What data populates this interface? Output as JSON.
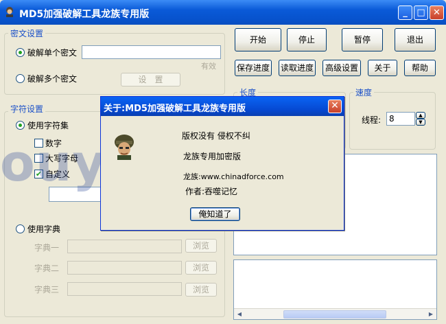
{
  "window": {
    "title": "MD5加强破解工具龙族专用版",
    "minimize": "_",
    "maximize": "□",
    "close": "✕"
  },
  "cipher_group": {
    "title": "密文设置",
    "single_radio": "破解单个密文",
    "single_value": "",
    "valid_label": "有效",
    "multi_radio": "破解多个密文",
    "set_button": "设　置"
  },
  "charset_group": {
    "title": "字符设置",
    "use_charset": "使用字符集",
    "digits": "数字",
    "uppercase": "大写字母",
    "custom": "自定义",
    "custom_value": "",
    "use_dictionary": "使用字典",
    "dict1": "字典一",
    "dict2": "字典二",
    "dict3": "字典三",
    "browse": "浏览"
  },
  "toolbar": {
    "start": "开始",
    "stop": "停止",
    "pause": "暂停",
    "exit": "退出",
    "save_progress": "保存进度",
    "load_progress": "读取进度",
    "advanced": "高级设置",
    "about": "关于",
    "help": "帮助"
  },
  "length_group": {
    "title": "长度"
  },
  "speed_group": {
    "title": "速度",
    "threads_label": "线程:",
    "threads_value": "8"
  },
  "about_dialog": {
    "title": "关于:MD5加强破解工具龙族专用版",
    "line1": "版权没有 侵权不纠",
    "line2": "龙族专用加密版",
    "line3": "龙族:www.chinadforce.com",
    "line4": "作者:吞噬记忆",
    "ok_button": "俺知道了"
  },
  "watermark": "ouyaoxiazai",
  "colors": {
    "titlebar": "#0752cc",
    "group_title": "#1a50c8",
    "face": "#ece9d8"
  }
}
